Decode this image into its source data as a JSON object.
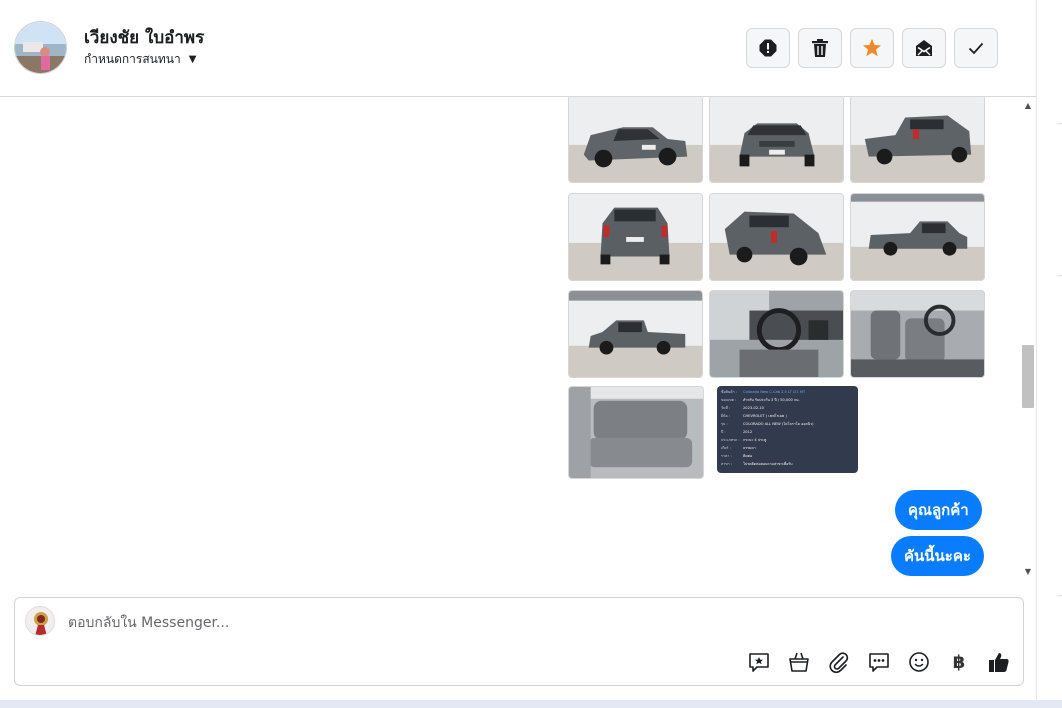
{
  "header": {
    "contact_name": "เวียงชัย ใบอำพร",
    "assign_label": "กำหนดการสนทนา",
    "actions": [
      {
        "name": "report-spam-button",
        "icon": "alert-icon"
      },
      {
        "name": "delete-button",
        "icon": "trash-icon"
      },
      {
        "name": "star-button",
        "icon": "star-icon"
      },
      {
        "name": "mark-unread-button",
        "icon": "envelope-icon"
      },
      {
        "name": "mark-done-button",
        "icon": "check-icon"
      }
    ]
  },
  "messages": {
    "photos": [
      {
        "id": "photo-1",
        "desc": "gray pickup front three-quarter"
      },
      {
        "id": "photo-2",
        "desc": "gray pickup front"
      },
      {
        "id": "photo-3",
        "desc": "gray pickup rear three-quarter"
      },
      {
        "id": "photo-4",
        "desc": "gray pickup rear"
      },
      {
        "id": "photo-5",
        "desc": "gray pickup rear three-quarter left"
      },
      {
        "id": "photo-6",
        "desc": "gray pickup side"
      },
      {
        "id": "photo-7",
        "desc": "gray pickup side left"
      },
      {
        "id": "photo-8",
        "desc": "dashboard interior"
      },
      {
        "id": "photo-9",
        "desc": "front seats interior"
      },
      {
        "id": "photo-10",
        "desc": "rear seats interior"
      }
    ],
    "spec_card": {
      "rows": [
        {
          "k": "ชื่อสินค้า :",
          "v": "Colorado New C-Cab 2.5 LT LT1 MT"
        },
        {
          "k": "ขอบเขต :",
          "v": "สำหรับ รับประกัน 3 ปี / 50,000 กม."
        },
        {
          "k": "วันที่ :",
          "v": "2023-02-10"
        },
        {
          "k": "ยี่ห้อ :",
          "v": "CHEVROLET ( เชฟโรเลต )"
        },
        {
          "k": "รุ่น :",
          "v": "COLORADO ALL NEW (โคโลราโด ออลนิว)"
        },
        {
          "k": "ปี :",
          "v": "2012"
        },
        {
          "k": "ประเภทรถ :",
          "v": "กระบะ 4 ประตู"
        },
        {
          "k": "เกียร์ :",
          "v": "ธรรมดา"
        },
        {
          "k": "ราคา :",
          "v": "ติดต่อ"
        },
        {
          "k": "สาขา :",
          "v": "โปรดติดต่อสอบถามสาขาเพื่อรับ"
        }
      ]
    },
    "bubbles": [
      "คุณลูกค้า",
      "คันนี้นะคะ"
    ]
  },
  "composer": {
    "placeholder": "ตอบกลับใน Messenger...",
    "tools": [
      {
        "name": "saved-reply-button",
        "icon": "saved-reply-icon"
      },
      {
        "name": "shop-button",
        "icon": "shopping-bag-icon"
      },
      {
        "name": "attach-button",
        "icon": "paperclip-icon"
      },
      {
        "name": "chat-options-button",
        "icon": "chat-bubble-icon"
      },
      {
        "name": "emoji-button",
        "icon": "smiley-icon"
      },
      {
        "name": "payment-button",
        "icon": "baht-icon",
        "glyph": "฿"
      },
      {
        "name": "like-button",
        "icon": "thumbs-up-icon"
      }
    ]
  }
}
